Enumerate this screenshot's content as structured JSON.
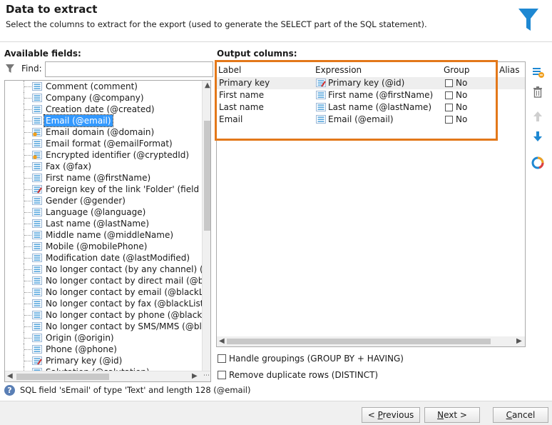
{
  "header": {
    "title": "Data to extract",
    "subtitle": "Select the columns to extract for the export (used to generate the SELECT part of the SQL statement)."
  },
  "left": {
    "label": "Available fields:",
    "find_label": "Find:",
    "find_value": "",
    "items": [
      {
        "text": "Comment (comment)",
        "icon": "field-icon"
      },
      {
        "text": "Company (@company)",
        "icon": "field-icon"
      },
      {
        "text": "Creation date (@created)",
        "icon": "field-icon"
      },
      {
        "text": "Email (@email)",
        "icon": "field-icon",
        "selected": true
      },
      {
        "text": "Email domain (@domain)",
        "icon": "computed-field-icon"
      },
      {
        "text": "Email format (@emailFormat)",
        "icon": "field-icon"
      },
      {
        "text": "Encrypted identifier (@cryptedId)",
        "icon": "computed-field-icon"
      },
      {
        "text": "Fax (@fax)",
        "icon": "field-icon"
      },
      {
        "text": "First name (@firstName)",
        "icon": "field-icon"
      },
      {
        "text": "Foreign key of the link 'Folder' (field 'id') (",
        "icon": "key-field-icon"
      },
      {
        "text": "Gender (@gender)",
        "icon": "field-icon"
      },
      {
        "text": "Language (@language)",
        "icon": "field-icon"
      },
      {
        "text": "Last name (@lastName)",
        "icon": "field-icon"
      },
      {
        "text": "Middle name (@middleName)",
        "icon": "field-icon"
      },
      {
        "text": "Mobile (@mobilePhone)",
        "icon": "field-icon"
      },
      {
        "text": "Modification date (@lastModified)",
        "icon": "field-icon"
      },
      {
        "text": "No longer contact (by any channel) (@bla",
        "icon": "field-icon"
      },
      {
        "text": "No longer contact by direct mail (@blackl",
        "icon": "field-icon"
      },
      {
        "text": "No longer contact by email (@blackListEr",
        "icon": "field-icon"
      },
      {
        "text": "No longer contact by fax (@blackListFax)",
        "icon": "field-icon"
      },
      {
        "text": "No longer contact by phone (@blackListP",
        "icon": "field-icon"
      },
      {
        "text": "No longer contact by SMS/MMS (@blackl",
        "icon": "field-icon"
      },
      {
        "text": "Origin (@origin)",
        "icon": "field-icon"
      },
      {
        "text": "Phone (@phone)",
        "icon": "field-icon"
      },
      {
        "text": "Primary key (@id)",
        "icon": "key-field-icon"
      },
      {
        "text": "Salutation (@salutation)",
        "icon": "field-icon"
      }
    ]
  },
  "output": {
    "label": "Output columns:",
    "columns": {
      "label": "Label",
      "expression": "Expression",
      "group": "Group",
      "alias": "Alias"
    },
    "rows": [
      {
        "label": "Primary key",
        "expression": "Primary key (@id)",
        "icon": "key-field-icon",
        "group": "No"
      },
      {
        "label": "First name",
        "expression": "First name (@firstName)",
        "icon": "field-icon",
        "group": "No"
      },
      {
        "label": "Last name",
        "expression": "Last name (@lastName)",
        "icon": "field-icon",
        "group": "No"
      },
      {
        "label": "Email",
        "expression": "Email (@email)",
        "icon": "field-icon",
        "group": "No"
      }
    ]
  },
  "options": {
    "groupings": "Handle groupings (GROUP BY + HAVING)",
    "distinct": "Remove duplicate rows (DISTINCT)"
  },
  "status": "SQL field 'sEmail' of type 'Text' and length 128 (@email)",
  "footer": {
    "previous_pre": "< ",
    "previous_u": "P",
    "previous_rest": "revious",
    "next_u": "N",
    "next_rest": "ext >",
    "cancel_u": "C",
    "cancel_rest": "ancel"
  },
  "colors": {
    "accent": "#e3781a",
    "selection": "#3399ff",
    "icon_blue": "#1e88d2"
  }
}
